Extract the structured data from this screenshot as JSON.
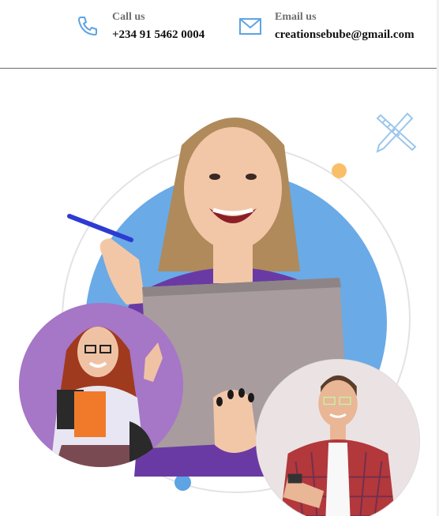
{
  "contact": {
    "phone": {
      "label": "Call us",
      "value": "+234 91 5462 0004",
      "icon": "phone-icon"
    },
    "email": {
      "label": "Email us",
      "value": "creationsebube@gmail.com",
      "icon": "mail-icon"
    }
  },
  "colors": {
    "accent_blue": "#6aaae6",
    "orange_dot": "#f9bf68",
    "purple_bg": "#a676c7",
    "label_gray": "#6f6f6f"
  }
}
